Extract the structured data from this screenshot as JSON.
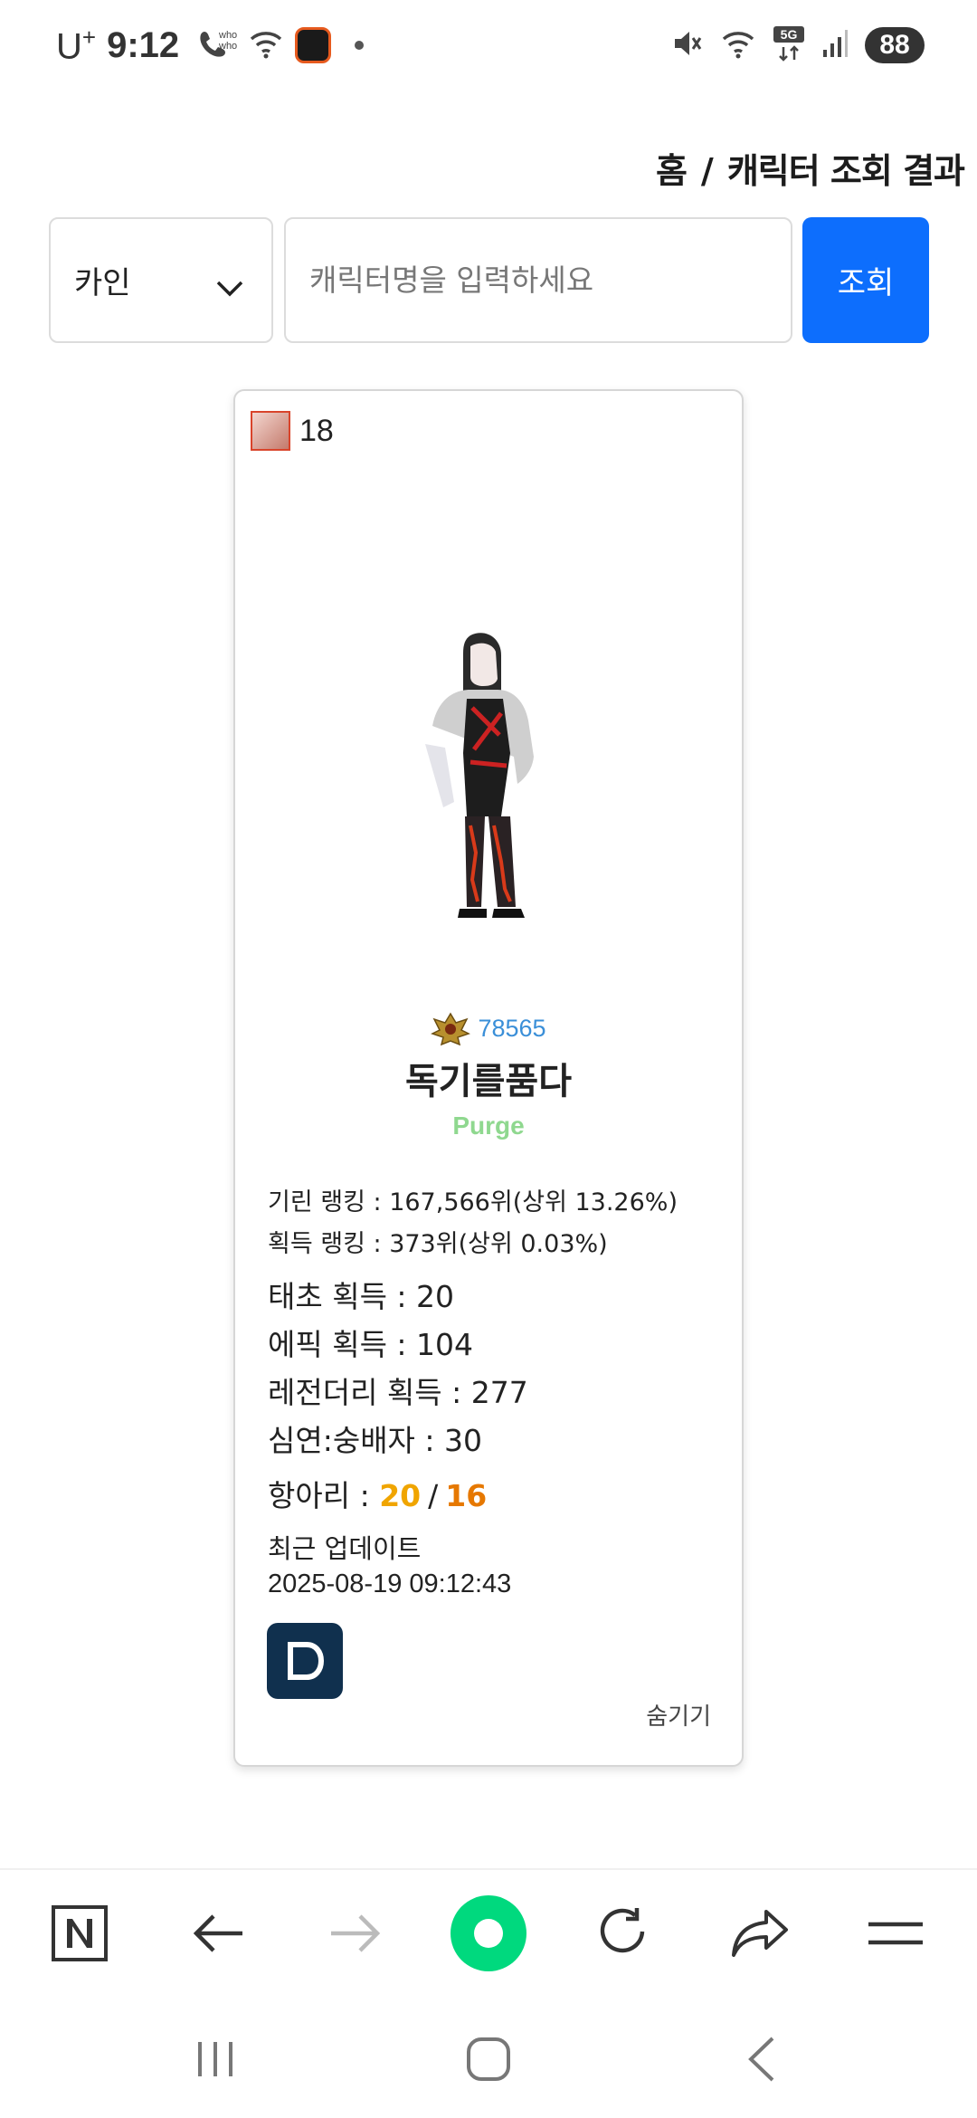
{
  "status_bar": {
    "carrier": "U",
    "carrier_sup": "+",
    "time": "9:12",
    "network": "5G",
    "battery": "88"
  },
  "breadcrumb": {
    "home": "홈",
    "separator": "/",
    "current": "캐릭터 조회 결과"
  },
  "search": {
    "server": "카인",
    "placeholder": "캐릭터명을 입력하세요",
    "button": "조회"
  },
  "character": {
    "level": "18",
    "guild_number": "78565",
    "name": "독기를품다",
    "class": "Purge",
    "rankings": [
      "기린 랭킹 : 167,566위(상위 13.26%)",
      "획득 랭킹 : 373위(상위 0.03%)"
    ],
    "counts": [
      "태초 획득 : 20",
      "에픽 획득 : 104",
      "레전더리 획득 : 277",
      "심연:숭배자 : 30"
    ],
    "jar_label": "항아리 : ",
    "jar_value_1": "20",
    "jar_separator": "/",
    "jar_value_2": "16",
    "update_label": "최근 업데이트",
    "update_time": "2025-08-19 09:12:43",
    "hide_button": "숨기기"
  },
  "colors": {
    "primary": "#0d6efd",
    "class_text": "#8fd88f",
    "guild_number": "#3a8fd8",
    "jar_1": "#f0a500",
    "jar_2": "#e67800",
    "dak_button": "#10304e",
    "toolbar_accent": "#00d97e"
  },
  "toolbar_icons": [
    "naver-n-icon",
    "back-arrow-icon",
    "forward-arrow-icon",
    "home-green-icon",
    "refresh-icon",
    "share-icon",
    "menu-icon"
  ],
  "nav_icons": [
    "recents-icon",
    "home-icon",
    "back-icon"
  ]
}
